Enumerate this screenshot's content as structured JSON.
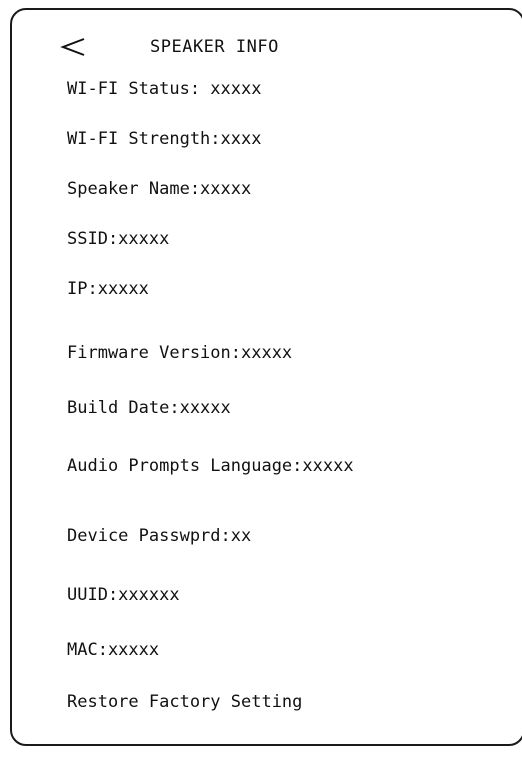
{
  "header": {
    "title": "SPEAKER INFO",
    "back_icon": "chevron-left-icon"
  },
  "info": {
    "wifi_status": "WI-FI Status: xxxxx",
    "wifi_strength": "WI-FI Strength:xxxx",
    "speaker_name": "Speaker Name:xxxxx",
    "ssid": "SSID:xxxxx",
    "ip": "IP:xxxxx",
    "firmware_version": "Firmware Version:xxxxx",
    "build_date": "Build Date:xxxxx",
    "audio_prompts_language": "Audio Prompts Language:xxxxx",
    "device_password": "Device Passwprd:xx",
    "uuid": "UUID:xxxxxx",
    "mac": "MAC:xxxxx"
  },
  "actions": {
    "restore_factory_setting": "Restore Factory Setting"
  }
}
